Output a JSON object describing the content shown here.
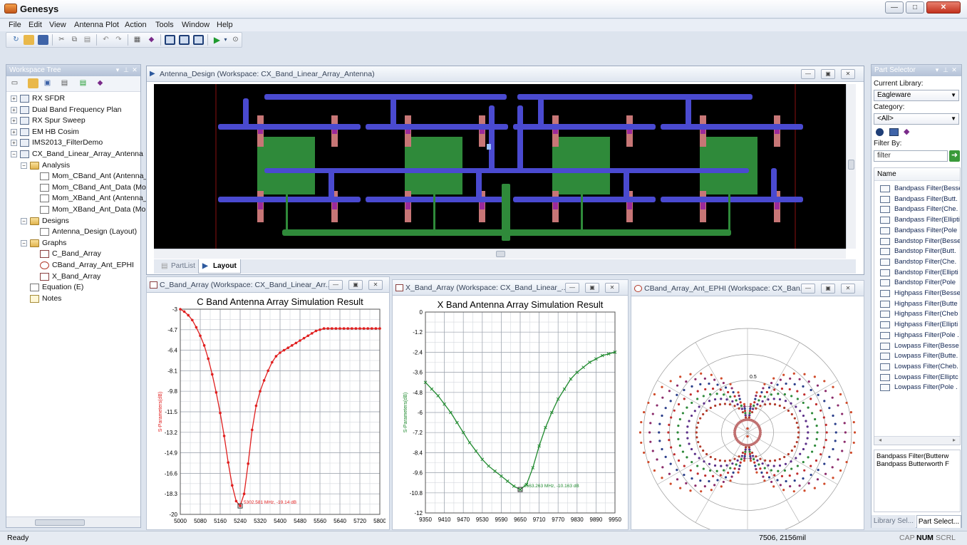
{
  "app": {
    "title": "Genesys"
  },
  "window_controls": {
    "minimize": "—",
    "maximize": "□",
    "close": "✕"
  },
  "menu": [
    "File",
    "Edit",
    "View",
    "Antenna Plot",
    "Action",
    "Tools",
    "Window",
    "Help"
  ],
  "toolbar_icons": [
    "new-schematic-icon",
    "open-icon",
    "save-icon",
    "cut-icon",
    "copy-icon",
    "paste-icon",
    "undo-icon",
    "redo-icon",
    "print-icon",
    "properties-icon",
    "tile-icon",
    "cascade-icon",
    "grid-icon",
    "run-icon",
    "dropdown-icon",
    "help-icon"
  ],
  "workspace_tree": {
    "title": "Workspace Tree",
    "items": [
      {
        "label": "RX SFDR",
        "level": 0,
        "icon": "workspace-icon",
        "expander": "+"
      },
      {
        "label": "Dual Band Frequency Plan",
        "level": 0,
        "icon": "workspace-icon",
        "expander": "+"
      },
      {
        "label": "RX Spur Sweep",
        "level": 0,
        "icon": "workspace-icon",
        "expander": "+"
      },
      {
        "label": "EM HB Cosim",
        "level": 0,
        "icon": "workspace-icon",
        "expander": "+"
      },
      {
        "label": "IMS2013_FilterDemo",
        "level": 0,
        "icon": "workspace-icon",
        "expander": "+"
      },
      {
        "label": "CX_Band_Linear_Array_Antenna",
        "level": 0,
        "icon": "workspace-icon",
        "expander": "−"
      },
      {
        "label": "Analysis",
        "level": 1,
        "icon": "folder-icon",
        "expander": "−"
      },
      {
        "label": "Mom_CBand_Ant (Antenna_D",
        "level": 2,
        "icon": "analysis-icon",
        "expander": ""
      },
      {
        "label": "Mom_CBand_Ant_Data (Mom",
        "level": 2,
        "icon": "dataset-icon",
        "expander": ""
      },
      {
        "label": "Mom_XBand_Ant (Antenna_D",
        "level": 2,
        "icon": "analysis-icon",
        "expander": ""
      },
      {
        "label": "Mom_XBand_Ant_Data (Mom",
        "level": 2,
        "icon": "dataset-icon",
        "expander": ""
      },
      {
        "label": "Designs",
        "level": 1,
        "icon": "folder-icon",
        "expander": "−"
      },
      {
        "label": "Antenna_Design (Layout)",
        "level": 2,
        "icon": "layout-icon",
        "expander": ""
      },
      {
        "label": "Graphs",
        "level": 1,
        "icon": "folder-icon",
        "expander": "−"
      },
      {
        "label": "C_Band_Array",
        "level": 2,
        "icon": "graph-icon",
        "expander": ""
      },
      {
        "label": "CBand_Array_Ant_EPHI",
        "level": 2,
        "icon": "polar-graph-icon",
        "expander": ""
      },
      {
        "label": "X_Band_Array",
        "level": 2,
        "icon": "graph-icon",
        "expander": ""
      },
      {
        "label": "Equation (E)",
        "level": 1,
        "icon": "equation-icon",
        "expander": ""
      },
      {
        "label": "Notes",
        "level": 1,
        "icon": "notes-icon",
        "expander": ""
      }
    ]
  },
  "layout_window": {
    "title": "Antenna_Design (Workspace: CX_Band_Linear_Array_Antenna)",
    "tabs": [
      "PartList",
      "Layout"
    ],
    "active_tab": "Layout"
  },
  "c_band_window": {
    "title": "C_Band_Array (Workspace: CX_Band_Linear_Arr..."
  },
  "x_band_window": {
    "title": "X_Band_Array (Workspace: CX_Band_Linear_..."
  },
  "polar_window": {
    "title": "CBand_Array_Ant_EPHI (Workspace: CX_Ban..."
  },
  "chart_data": [
    {
      "type": "line",
      "title": "C Band Antenna Array Simulation Result",
      "ylabel": "S-Parameters(dB)",
      "color": "#e01e1e",
      "xlim": [
        5000,
        5800
      ],
      "ylim": [
        -20,
        -3
      ],
      "x_ticks": [
        5000,
        5080,
        5160,
        5240,
        5320,
        5400,
        5480,
        5560,
        5640,
        5720,
        5800
      ],
      "y_ticks": [
        -3,
        -4.7,
        -6.4,
        -8.1,
        -9.8,
        -11.5,
        -13.2,
        -14.9,
        -16.6,
        -18.3,
        -20
      ],
      "grid": true,
      "x": [
        5000,
        5016,
        5032,
        5048,
        5064,
        5080,
        5096,
        5112,
        5128,
        5144,
        5160,
        5176,
        5192,
        5208,
        5224,
        5240,
        5256,
        5272,
        5288,
        5304,
        5320,
        5336,
        5352,
        5368,
        5384,
        5400,
        5416,
        5432,
        5448,
        5464,
        5480,
        5496,
        5512,
        5528,
        5544,
        5560,
        5576,
        5592,
        5608,
        5624,
        5640,
        5656,
        5672,
        5688,
        5704,
        5720,
        5736,
        5752,
        5768,
        5784,
        5800
      ],
      "y": [
        -3.0,
        -3.2,
        -3.5,
        -3.9,
        -4.5,
        -5.2,
        -6.0,
        -7.1,
        -8.4,
        -9.9,
        -11.6,
        -13.5,
        -15.7,
        -17.6,
        -18.9,
        -19.3,
        -18.3,
        -15.8,
        -13.0,
        -11.0,
        -9.8,
        -8.9,
        -8.1,
        -7.4,
        -6.9,
        -6.6,
        -6.4,
        -6.2,
        -6.0,
        -5.8,
        -5.6,
        -5.4,
        -5.2,
        -5.0,
        -4.8,
        -4.7,
        -4.6,
        -4.6,
        -4.6,
        -4.6,
        -4.6,
        -4.6,
        -4.6,
        -4.6,
        -4.6,
        -4.6,
        -4.6,
        -4.6,
        -4.6,
        -4.6,
        -4.6
      ],
      "annotation": "5302.581 MHz, -19.14 dB"
    },
    {
      "type": "line",
      "title": "X Band Antenna Array Simulation Result",
      "ylabel": "S-Parameters(dB)",
      "color": "#1f8a2e",
      "xlim": [
        9350,
        9950
      ],
      "ylim": [
        -12,
        0
      ],
      "x_ticks": [
        9350,
        9410,
        9470,
        9530,
        9590,
        9650,
        9710,
        9770,
        9830,
        9890,
        9950
      ],
      "y_ticks": [
        0,
        -1.2,
        -2.4,
        -3.6,
        -4.8,
        -6,
        -7.2,
        -8.4,
        -9.6,
        -10.8,
        -12
      ],
      "grid": true,
      "x": [
        9350,
        9370,
        9390,
        9410,
        9430,
        9450,
        9470,
        9490,
        9510,
        9530,
        9550,
        9570,
        9590,
        9610,
        9630,
        9650,
        9670,
        9690,
        9710,
        9730,
        9750,
        9770,
        9790,
        9810,
        9830,
        9850,
        9870,
        9890,
        9910,
        9930,
        9950
      ],
      "y": [
        -4.2,
        -4.6,
        -5.0,
        -5.5,
        -6.0,
        -6.6,
        -7.2,
        -7.8,
        -8.3,
        -8.8,
        -9.2,
        -9.5,
        -9.8,
        -10.1,
        -10.4,
        -10.6,
        -10.3,
        -9.3,
        -8.0,
        -6.9,
        -6.0,
        -5.2,
        -4.6,
        -4.0,
        -3.6,
        -3.3,
        -3.0,
        -2.8,
        -2.6,
        -2.5,
        -2.4
      ],
      "annotation": "9663.263 MHz, -10.163 dB"
    },
    {
      "type": "polar",
      "rings": 4,
      "spokes": 12,
      "label": "0.5"
    }
  ],
  "part_selector": {
    "title": "Part Selector",
    "library_label": "Current Library:",
    "library_value": "Eagleware",
    "category_label": "Category:",
    "category_value": "<All>",
    "filter_label": "Filter By:",
    "filter_value": "filter",
    "list_header": "Name",
    "parts": [
      "Bandpass Filter(Besse",
      "Bandpass Filter(Butt.",
      "Bandpass Filter(Che.",
      "Bandpass Filter(Ellipti",
      "Bandpass Filter(Pole",
      "Bandstop Filter(Besse",
      "Bandstop Filter(Butt.",
      "Bandstop Filter(Che.",
      "Bandstop Filter(Ellipti",
      "Bandstop Filter(Pole",
      "Highpass Filter(Besse",
      "Highpass Filter(Butte",
      "Highpass Filter(Cheb",
      "Highpass Filter(Ellipti",
      "Highpass Filter(Pole .",
      "Lowpass Filter(Besse",
      "Lowpass Filter(Butte.",
      "Lowpass Filter(Cheb.",
      "Lowpass Filter(Elliptc",
      "Lowpass Filter(Pole ."
    ],
    "description_line1": "Bandpass Filter(Butterw",
    "description_line2": "Bandpass Butterworth F",
    "tabs": [
      "Library Sel...",
      "Part Select..."
    ]
  },
  "status": {
    "left": "Ready",
    "coords": "7506,  2156mil",
    "cap": "CAP",
    "num": "NUM",
    "scrl": "SCRL"
  }
}
